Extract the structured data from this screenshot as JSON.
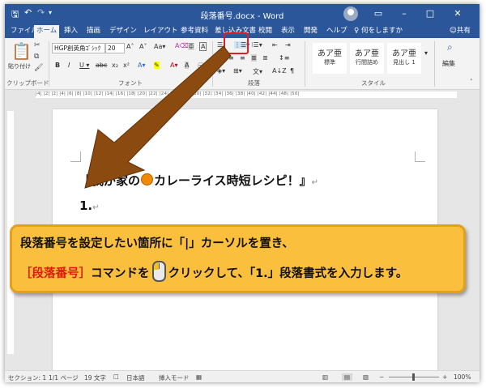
{
  "window": {
    "title": "段落番号.docx - Word",
    "tell_me": "何をしますか",
    "share": "共有"
  },
  "tabs": [
    "ファイル",
    "ホーム",
    "挿入",
    "描画",
    "デザイン",
    "レイアウト",
    "参考資料",
    "差し込み文書",
    "校閲",
    "表示",
    "開発",
    "ヘルプ"
  ],
  "ribbon": {
    "paste_label": "貼り付け",
    "clipboard_label": "クリップボード",
    "font_name": "HGP創英角ｺﾞｼｯｸ",
    "font_size": "20",
    "font_group_label": "フォント",
    "paragraph_group_label": "段落",
    "styles_group_label": "スタイル",
    "edit_label": "編集",
    "styles": [
      {
        "sample": "あア亜",
        "name": "標準"
      },
      {
        "sample": "あア亜",
        "name": "行間詰め"
      },
      {
        "sample": "あア亜",
        "name": "見出し 1"
      }
    ]
  },
  "ruler_text": "|4| |2| |2| |4| |6| |8| |10| |12| |14| |16| |18| |20| |22| |24| |26| |28| |30| |32| |34| |36| |38| |40| |42| |44| |48| |50|",
  "document": {
    "heading": "『我が家の",
    "heading_rest": "カレーライス時短レシピ！』",
    "return_mark": "↵",
    "numbered_item": "1."
  },
  "status": {
    "section": "セクション: 1",
    "page": "1/1 ページ",
    "words": "19 文字",
    "language": "日本語",
    "mode": "挿入モード",
    "zoom": "100%"
  },
  "callout": {
    "line1": "段落番号を設定したい箇所に「|」カーソルを置き、",
    "command": "［段落番号］",
    "line2_mid": "コマンドを",
    "line2_end": "クリックして、「1.」段落書式を入力します。"
  },
  "colors": {
    "word_blue": "#2b579a",
    "callout_fill": "#fbbf3e",
    "command_red": "#e0180c",
    "arrow_brown": "#8a4a10"
  }
}
